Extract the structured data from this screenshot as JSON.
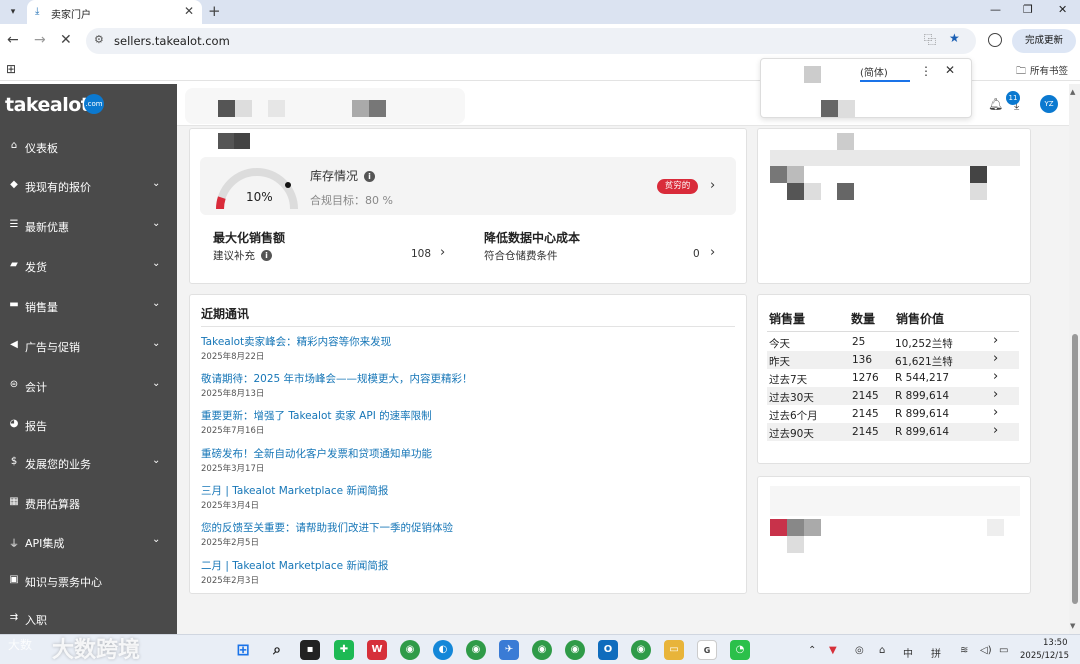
{
  "browser": {
    "tab_title": "卖家门户",
    "url": "sellers.takealot.com",
    "update_label": "完成更新",
    "bookmarks_label": "所有书签",
    "translate_lang": "(简体)"
  },
  "brand": {
    "name": "takealot",
    "badge": ".com",
    "accent": "#0b79d0",
    "sidebar_bg": "#4a4a4a"
  },
  "sidebar": {
    "items": [
      {
        "label": "仪表板",
        "icon": "home-icon"
      },
      {
        "label": "我现有的报价",
        "icon": "tag-icon"
      },
      {
        "label": "最新优惠",
        "icon": "list-icon"
      },
      {
        "label": "发货",
        "icon": "truck-icon"
      },
      {
        "label": "销售量",
        "icon": "card-icon"
      },
      {
        "label": "广告与促销",
        "icon": "megaphone-icon"
      },
      {
        "label": "会计",
        "icon": "bank-icon"
      },
      {
        "label": "报告",
        "icon": "chart-icon"
      },
      {
        "label": "发展您的业务",
        "icon": "dollar-icon"
      },
      {
        "label": "费用估算器",
        "icon": "calculator-icon"
      },
      {
        "label": "API集成",
        "icon": "plug-icon"
      },
      {
        "label": "知识与票务中心",
        "icon": "ticket-icon"
      },
      {
        "label": "入职",
        "icon": "signpost-icon"
      }
    ]
  },
  "header": {
    "notification_count": "11",
    "avatar_initials": "YZ"
  },
  "stock": {
    "percent_label": "10%",
    "percent_value": 10,
    "title": "库存情况",
    "target_label": "合规目标：80 %",
    "status": "贫穷的",
    "status_color": "#d92b3a"
  },
  "maximize": {
    "title": "最大化销售额",
    "sub": "建议补充",
    "count": "108"
  },
  "dc_cost": {
    "title": "降低数据中心成本",
    "sub": "符合仓储费条件",
    "count": "0"
  },
  "news": {
    "heading": "近期通讯",
    "items": [
      {
        "title": "Takealot卖家峰会：精彩内容等你来发现",
        "date": "2025年8月22日"
      },
      {
        "title": "敬请期待：2025 年市场峰会——规模更大，内容更精彩！",
        "date": "2025年8月13日"
      },
      {
        "title": "重要更新：增强了 Takealot 卖家 API 的速率限制",
        "date": "2025年7月16日"
      },
      {
        "title": "重磅发布！全新自动化客户发票和贷项通知单功能",
        "date": "2025年3月17日"
      },
      {
        "title": "三月 | Takealot Marketplace 新闻简报",
        "date": "2025年3月4日"
      },
      {
        "title": "您的反馈至关重要：请帮助我们改进下一季的促销体验",
        "date": "2025年2月5日"
      },
      {
        "title": "二月 | Takealot Marketplace 新闻简报",
        "date": "2025年2月3日"
      }
    ]
  },
  "sales": {
    "headers": [
      "销售量",
      "数量",
      "销售价值"
    ],
    "rows": [
      {
        "period": "今天",
        "qty": "25",
        "value": "10,252兰特"
      },
      {
        "period": "昨天",
        "qty": "136",
        "value": "61,621兰特"
      },
      {
        "period": "过去7天",
        "qty": "1276",
        "value": "R 544,217"
      },
      {
        "period": "过去30天",
        "qty": "2145",
        "value": "R 899,614"
      },
      {
        "period": "过去6个月",
        "qty": "2145",
        "value": "R 899,614"
      },
      {
        "period": "过去90天",
        "qty": "2145",
        "value": "R 899,614"
      }
    ]
  },
  "taskbar": {
    "ime_mode": "中",
    "ime_name": "拼",
    "time": "13:50",
    "date": "2025/12/15",
    "watermark": "大数跨境",
    "watermark_logo": "大数"
  }
}
